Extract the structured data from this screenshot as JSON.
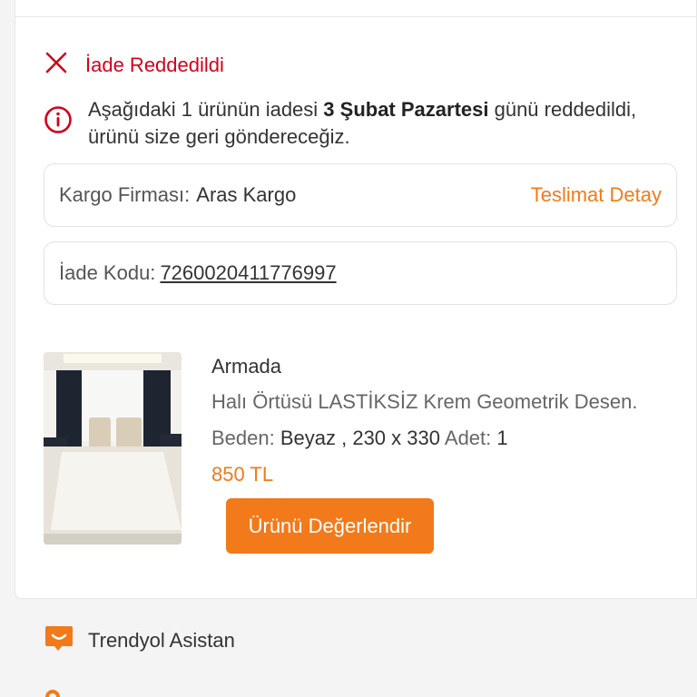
{
  "status": {
    "title": "İade Reddedildi",
    "icon": "close-icon",
    "color": "#d0021b"
  },
  "info": {
    "icon": "info-circle-icon",
    "text_before": "Aşağıdaki 1 ürünün iadesi ",
    "text_bold": "3 Şubat Pazartesi",
    "text_after": " günü reddedildi, ürünü size geri göndereceğiz."
  },
  "cargo": {
    "label": "Kargo Firması:",
    "value": "Aras Kargo",
    "link": "Teslimat Detay"
  },
  "return_code": {
    "label": "İade Kodu:",
    "value": "7260020411776997"
  },
  "product": {
    "brand": "Armada",
    "name": "Halı Örtüsü LASTİKSİZ Krem Geometrik Desen.",
    "size_label": "Beden:",
    "size_value": "Beyaz , 230 x 330",
    "qty_label": "Adet:",
    "qty_value": "1",
    "price": "850 TL",
    "image": "living-room-rug-photo",
    "rate_button": "Ürünü Değerlendir"
  },
  "assistant": {
    "icon": "chat-smile-icon",
    "label": "Trendyol Asistan"
  },
  "colors": {
    "accent": "#f27a1a",
    "error": "#d0021b"
  }
}
